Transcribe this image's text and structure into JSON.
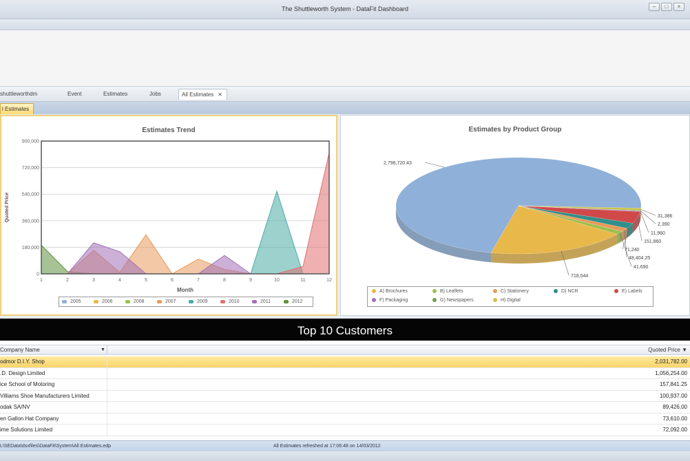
{
  "window": {
    "title": "The Shuttleworth System - DataFit Dashboard"
  },
  "tabs": [
    {
      "label": "shuttleworthdm"
    },
    {
      "label": "Event"
    },
    {
      "label": "Estimates"
    },
    {
      "label": "Jobs"
    },
    {
      "label": "All Estimates",
      "active": true,
      "close": "✕"
    }
  ],
  "subtab": {
    "label": "l Estimates"
  },
  "trend_chart": {
    "title": "Estimates Trend",
    "chart_data": {
      "type": "area",
      "title": "Estimates Trend",
      "xlabel": "Month",
      "ylabel": "Quoted Price",
      "x": [
        1,
        2,
        3,
        4,
        5,
        6,
        7,
        8,
        9,
        10,
        11,
        12
      ],
      "ylim": [
        0,
        900000
      ],
      "yticks": [
        "0",
        "180,000",
        "360,000",
        "540,000",
        "720,000",
        "900,000"
      ],
      "series": [
        {
          "name": "2005",
          "color": "#8fb0d8",
          "values": [
            0,
            0,
            0,
            0,
            0,
            0,
            0,
            0,
            0,
            0,
            0,
            0
          ]
        },
        {
          "name": "2006",
          "color": "#e9b84a",
          "values": [
            0,
            0,
            0,
            0,
            0,
            0,
            0,
            0,
            0,
            0,
            0,
            0
          ]
        },
        {
          "name": "2008",
          "color": "#9cbf4c",
          "values": [
            0,
            0,
            0,
            0,
            0,
            0,
            0,
            0,
            0,
            0,
            0,
            0
          ]
        },
        {
          "name": "2007",
          "color": "#e89a5c",
          "values": [
            0,
            0,
            0,
            0,
            0,
            0,
            0,
            0,
            0,
            0,
            0,
            0
          ]
        },
        {
          "name": "2009",
          "color": "#4aaba6",
          "values": [
            0,
            0,
            0,
            0,
            0,
            0,
            0,
            0,
            0,
            0,
            0,
            0
          ]
        },
        {
          "name": "2010",
          "color": "#e07070",
          "values": [
            0,
            0,
            0,
            0,
            0,
            0,
            0,
            0,
            0,
            0,
            0,
            0
          ]
        },
        {
          "name": "2011",
          "color": "#a36fb8",
          "values": [
            0,
            0,
            0,
            0,
            0,
            0,
            0,
            0,
            0,
            0,
            0,
            0
          ]
        },
        {
          "name": "2012",
          "color": "#5e8f3e",
          "values": [
            0,
            0,
            0,
            0,
            0,
            0,
            0,
            0,
            0,
            0,
            0,
            0
          ]
        }
      ],
      "drawn": [
        {
          "series": "2012",
          "color": "#5e8f3e",
          "values": [
            195000,
            15000,
            0,
            0,
            0,
            0,
            0,
            0,
            0,
            0,
            0,
            0
          ]
        },
        {
          "series": "2007",
          "color": "#e89a5c",
          "values": [
            0,
            0,
            160000,
            10000,
            265000,
            0,
            100000,
            30000,
            0,
            0,
            0,
            0
          ]
        },
        {
          "series": "2011",
          "color": "#a36fb8",
          "values": [
            0,
            0,
            210000,
            150000,
            0,
            0,
            0,
            125000,
            0,
            0,
            0,
            0
          ]
        },
        {
          "series": "2009",
          "color": "#4aaba6",
          "values": [
            0,
            0,
            0,
            0,
            0,
            0,
            0,
            0,
            0,
            560000,
            0,
            0
          ]
        },
        {
          "series": "2010",
          "color": "#e07070",
          "values": [
            0,
            0,
            0,
            0,
            0,
            0,
            0,
            0,
            0,
            0,
            50000,
            820000
          ]
        }
      ]
    }
  },
  "pie_chart": {
    "title": "Estimates by Product Group",
    "chart_data": {
      "type": "pie",
      "title": "Estimates by Product Group",
      "slices": [
        {
          "label": "A) Brochures",
          "value": 2796720.43,
          "value_label": "2,796,720.43",
          "color": "#8fb0d8"
        },
        {
          "label": "B) Leaflets",
          "value": 718044,
          "value_label": "718,044",
          "color": "#e9b84a"
        },
        {
          "label": "C) Stationery",
          "value": 41690,
          "value_label": "41,690",
          "color": "#9cbf4c"
        },
        {
          "label": "D) NCR",
          "value": 48404.25,
          "value_label": "48,404.25",
          "color": "#e89a5c"
        },
        {
          "label": "E) Labels",
          "value": 71240,
          "value_label": "71,240",
          "color": "#2f8f8a"
        },
        {
          "label": "F) Packaging",
          "value": 151860,
          "value_label": "151,860",
          "color": "#d04848"
        },
        {
          "label": "G) Newspapers",
          "value": 11960,
          "value_label": "11,960",
          "color": "#a36fb8"
        },
        {
          "label": "H) Digital",
          "value": 2390,
          "value_label": "2,390",
          "color": "#6fa04e"
        },
        {
          "label": "",
          "value": 31386,
          "value_label": "31,386",
          "color": "#c7c24a"
        }
      ],
      "legend": [
        {
          "label": "A) Brochures",
          "color": "#e9b84a"
        },
        {
          "label": "B) Leaflets",
          "color": "#9cbf4c"
        },
        {
          "label": "C) Stationery",
          "color": "#e89a5c"
        },
        {
          "label": "D) NCR",
          "color": "#2f8f8a"
        },
        {
          "label": "E) Labels",
          "color": "#d04848"
        },
        {
          "label": "F) Packaging",
          "color": "#a36fb8"
        },
        {
          "label": "G) Newspapers",
          "color": "#6fa04e"
        },
        {
          "label": "H) Digital",
          "color": "#c7c24a"
        }
      ]
    }
  },
  "top_customers": {
    "title": "Top 10 Customers",
    "columns": {
      "name": "Company Name",
      "price": "Quoted Price"
    },
    "filter_icon": "▼",
    "rows": [
      {
        "name": "odmor D.I.Y. Shop",
        "price": "2,031,782.00",
        "selected": true
      },
      {
        "name": ".D. Design Limited",
        "price": "1,056,254.00"
      },
      {
        "name": "ice School of Motoring",
        "price": "157,841.25"
      },
      {
        "name": "Villiams Shoe Manufacturers Limited",
        "price": "100,937.00"
      },
      {
        "name": "odak SA/NV",
        "price": "89,426.00"
      },
      {
        "name": "en Gallon Hat Company",
        "price": "73,610.00"
      },
      {
        "name": "ime Solutions Limited",
        "price": "72,092.00"
      }
    ]
  },
  "status": {
    "path": "L\\SEData\\dsxfiles\\DataFit\\System\\All Estimates.edp",
    "message": "All Estimates refreshed at 17:06:48 on 14/03/2012"
  }
}
